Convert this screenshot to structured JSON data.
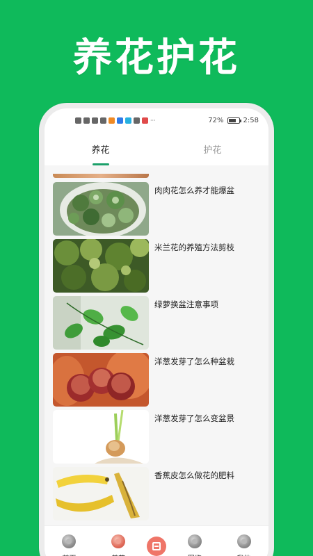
{
  "promo": {
    "title": "养花护花"
  },
  "status_bar": {
    "left_icons": [
      "hd-icon",
      "signal-icon",
      "signal-4g-icon",
      "wifi-icon",
      "app-icon-orange",
      "app-icon-blue",
      "app-icon-cyan",
      "cart-icon",
      "mail-icon"
    ],
    "more": "···",
    "battery": "72%",
    "battery_level": 0.72,
    "time": "2:58"
  },
  "tabs": [
    {
      "label": "养花",
      "active": true
    },
    {
      "label": "护花",
      "active": false
    }
  ],
  "articles": [
    {
      "title": "肉肉花怎么养才能爆盆",
      "image": "succulent-photo"
    },
    {
      "title": "米兰花的养殖方法剪枝",
      "image": "aglaia-shrub-photo"
    },
    {
      "title": "绿萝换盆注意事项",
      "image": "pothos-leaves-photo"
    },
    {
      "title": "洋葱发芽了怎么种盆栽",
      "image": "red-onions-photo"
    },
    {
      "title": "洋葱发芽了怎么变盆景",
      "image": "sprouting-onion-photo"
    },
    {
      "title": "香蕉皮怎么做花的肥料",
      "image": "banana-peel-photo"
    }
  ],
  "bottom_nav": {
    "items": [
      {
        "label": "首页",
        "icon": "home-icon",
        "active": false
      },
      {
        "label": "养花",
        "icon": "flower-care-icon",
        "active": true
      },
      {
        "label": "图鉴",
        "icon": "catalog-icon",
        "active": false
      },
      {
        "label": "我的",
        "icon": "profile-icon",
        "active": false
      }
    ],
    "center_icon": "scan-icon"
  },
  "colors": {
    "background": "#0fba5b",
    "tab_indicator": "#1ca06a",
    "active_nav": "#e06b5a",
    "scan_button": "#ef7568"
  }
}
